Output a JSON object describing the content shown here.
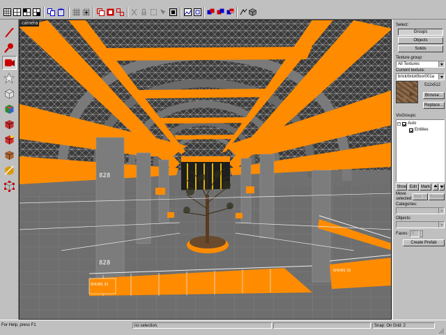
{
  "viewport": {
    "label": "camera"
  },
  "panel": {
    "select_label": "Select:",
    "groups_button": "Groups",
    "objects_button": "Objects",
    "solids_button": "Solids",
    "texture_group_label": "Texture group:",
    "texture_group_value": "All Textures",
    "current_texture_label": "Current texture:",
    "current_texture_value": "brick/brickfloor001a",
    "texture_size": "512x512",
    "browse_button": "Browse...",
    "replace_button": "Replace...",
    "visgroups_label": "VisGroups:",
    "visgroups": [
      {
        "label": "Auto",
        "checked": true,
        "expanded": true
      },
      {
        "label": "Entities",
        "checked": true
      }
    ],
    "show_button": "Show",
    "edit_button": "Edit",
    "mark_button": "Mark",
    "move_selected_label": "Move selected:",
    "new_group_button": "New VG",
    "remove_button": "Remove",
    "categories_label": "Categories:",
    "objects_label": "Objects:",
    "faces_label": "Faces:",
    "faces_value": "0",
    "create_prefab_button": "Create Prefab"
  },
  "status": {
    "help": "For Help, press F1",
    "selection": "no selection.",
    "snap": "Snap: On Grid: 2"
  },
  "scene": {
    "signs": [
      "828",
      "828",
      "SHUNS 32",
      "SHUNS 32"
    ]
  },
  "colors": {
    "accent": "#ff8c00",
    "viewport_bg": "#6c6c6c",
    "chrome": "#c0c0c0"
  },
  "icons": {
    "toolbar": [
      "grid-icon",
      "grid-icon",
      "grid-icon",
      "grid-icon",
      "grid-icon",
      "copy-icon",
      "paste-icon",
      "grid-toggle-icon",
      "snap-icon",
      "carve-icon",
      "hollow-icon",
      "group-icon",
      "ungroup-icon",
      "cut-icon",
      "texture-lock-icon",
      "select-all-icon",
      "zoom-icon",
      "hide-icon",
      "show-icon",
      "visgroup-icon",
      "visgroup-icon",
      "run-map-icon",
      "compile-icon",
      "cube-icon"
    ],
    "tools": [
      "selection-tool-icon",
      "magnify-tool-icon",
      "camera-tool-icon",
      "entity-tool-icon",
      "block-tool-icon",
      "texture-tool-icon",
      "apply-texture-icon",
      "decal-tool-icon",
      "overlay-tool-icon",
      "clip-tool-icon",
      "vertex-tool-icon"
    ]
  }
}
